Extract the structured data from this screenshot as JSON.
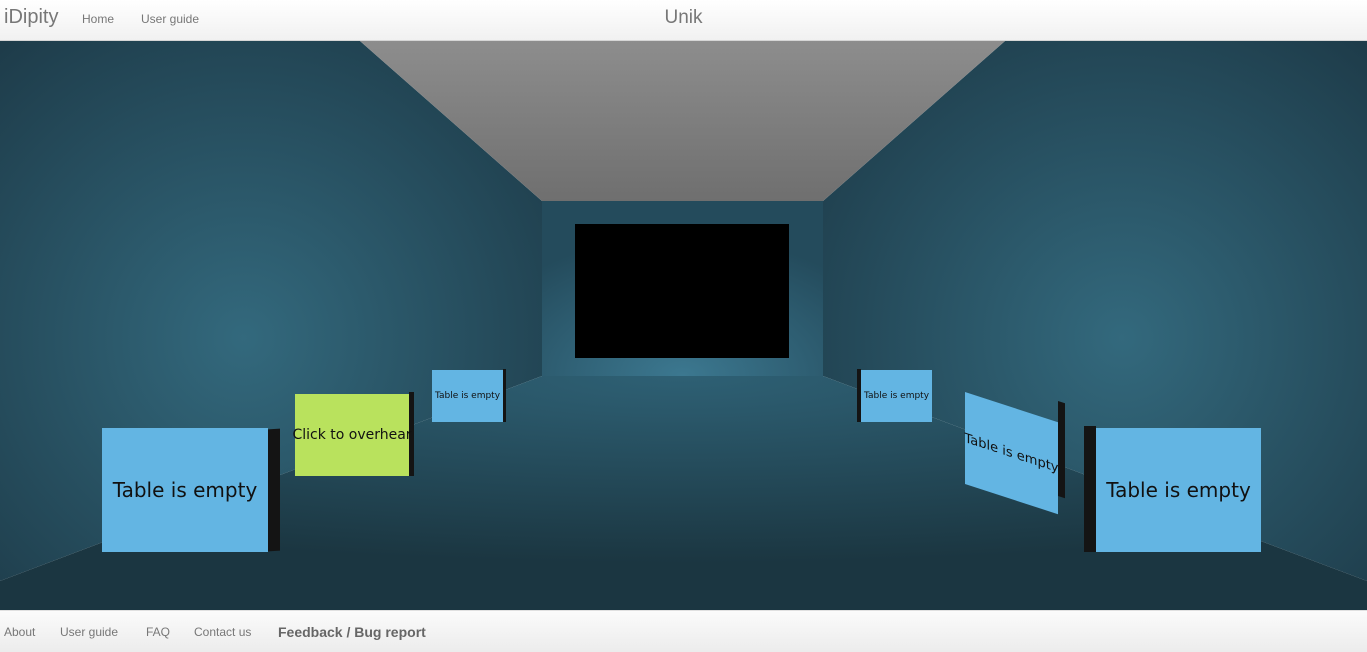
{
  "header": {
    "brand": "iDipity",
    "nav": {
      "home": "Home",
      "user_guide": "User guide"
    },
    "room_title": "Unik"
  },
  "scene": {
    "tables": {
      "left_front": "Table is empty",
      "left_middle": "Click to overhear",
      "left_back": "Table is empty",
      "right_back": "Table is empty",
      "right_middle": "Table is empty",
      "right_front": "Table is empty"
    },
    "colors": {
      "empty_table": "#63b5e3",
      "active_table": "#b9e25d",
      "walls": "#2f6175",
      "ceiling": "#8a8a8a",
      "screen": "#000000"
    }
  },
  "footer": {
    "about": "About",
    "user_guide": "User guide",
    "faq": "FAQ",
    "contact": "Contact us",
    "feedback": "Feedback / Bug report"
  }
}
